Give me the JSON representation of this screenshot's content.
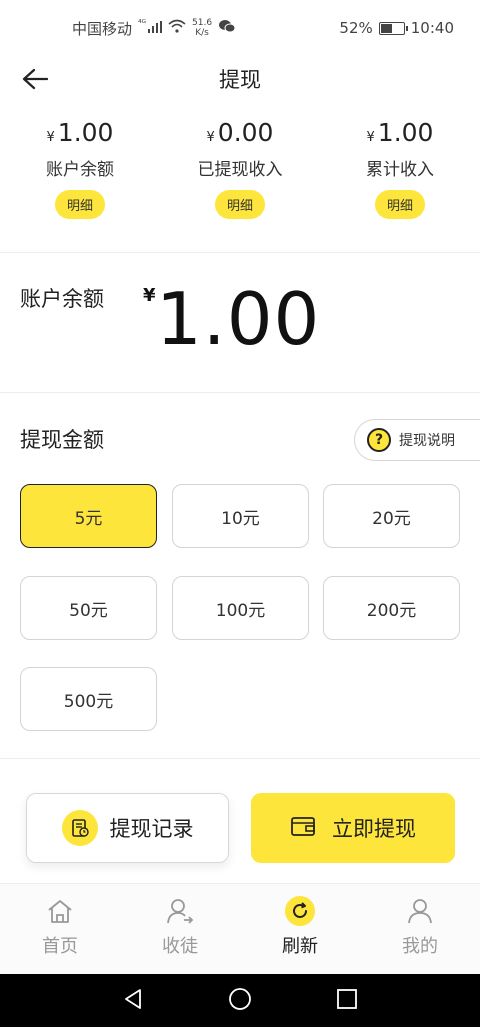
{
  "status_bar": {
    "carrier": "中国移动",
    "network": "⁴ᴳ",
    "speed_value": "51.6",
    "speed_unit": "K/s",
    "battery": "52%",
    "battery_level": 0.52,
    "time": "10:40"
  },
  "header": {
    "title": "提现"
  },
  "stats": [
    {
      "currency": "¥",
      "amount": "1.00",
      "label": "账户余额",
      "button": "明细"
    },
    {
      "currency": "¥",
      "amount": "0.00",
      "label": "已提现收入",
      "button": "明细"
    },
    {
      "currency": "¥",
      "amount": "1.00",
      "label": "累计收入",
      "button": "明细"
    }
  ],
  "balance": {
    "label": "账户余额",
    "currency": "¥",
    "value": "1.00"
  },
  "amount_section": {
    "title": "提现金额",
    "explain": "提现说明",
    "explain_icon": "?",
    "options": [
      "5元",
      "10元",
      "20元",
      "50元",
      "100元",
      "200元",
      "500元"
    ],
    "selected": "5元"
  },
  "actions": {
    "record": "提现记录",
    "withdraw": "立即提现"
  },
  "tabbar": {
    "items": [
      {
        "label": "首页",
        "icon": "home-icon"
      },
      {
        "label": "收徒",
        "icon": "user-arrow-icon"
      },
      {
        "label": "刷新",
        "icon": "refresh-icon"
      },
      {
        "label": "我的",
        "icon": "profile-icon"
      }
    ],
    "active": "刷新"
  },
  "colors": {
    "accent": "#fde53b",
    "text": "#222222",
    "muted": "#999999"
  }
}
